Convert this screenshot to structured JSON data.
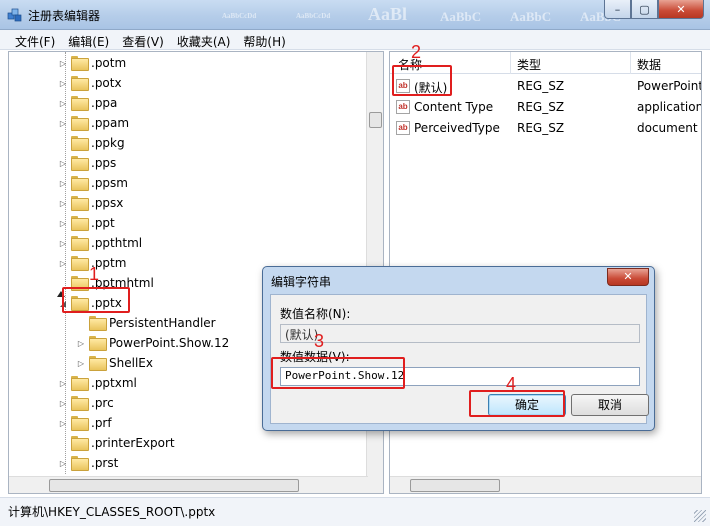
{
  "window": {
    "title": "注册表编辑器",
    "ghost_text": [
      "AaBbCcDd",
      "AaBbCcDd",
      "AaBl",
      "AaBbC",
      "AaBbC",
      "AaBbC"
    ],
    "buttons": {
      "minimize": "–",
      "maximize": "▢",
      "close": "✕"
    }
  },
  "menu": [
    "文件(F)",
    "编辑(E)",
    "查看(V)",
    "收藏夹(A)",
    "帮助(H)"
  ],
  "tree": {
    "items": [
      {
        "label": ".potm",
        "expandable": true
      },
      {
        "label": ".potx",
        "expandable": true
      },
      {
        "label": ".ppa",
        "expandable": true
      },
      {
        "label": ".ppam",
        "expandable": true
      },
      {
        "label": ".ppkg",
        "expandable": false
      },
      {
        "label": ".pps",
        "expandable": true
      },
      {
        "label": ".ppsm",
        "expandable": true
      },
      {
        "label": ".ppsx",
        "expandable": true
      },
      {
        "label": ".ppt",
        "expandable": true
      },
      {
        "label": ".ppthtml",
        "expandable": true
      },
      {
        "label": ".pptm",
        "expandable": true
      },
      {
        "label": ".pptmhtml",
        "expandable": false
      },
      {
        "label": ".pptx",
        "expanded": true
      },
      {
        "label": "PersistentHandler",
        "child": true,
        "expandable": false
      },
      {
        "label": "PowerPoint.Show.12",
        "child": true,
        "expandable": true
      },
      {
        "label": "ShellEx",
        "child": true,
        "expandable": true
      },
      {
        "label": ".pptxml",
        "expandable": true
      },
      {
        "label": ".prc",
        "expandable": true
      },
      {
        "label": ".prf",
        "expandable": true
      },
      {
        "label": ".printerExport",
        "expandable": false
      },
      {
        "label": ".prst",
        "expandable": true
      }
    ]
  },
  "list": {
    "columns": [
      "名称",
      "类型",
      "数据"
    ],
    "rows": [
      {
        "name": "(默认)",
        "type": "REG_SZ",
        "data": "PowerPoint"
      },
      {
        "name": "Content Type",
        "type": "REG_SZ",
        "data": "application"
      },
      {
        "name": "PerceivedType",
        "type": "REG_SZ",
        "data": "document"
      }
    ],
    "icon_text": "ab"
  },
  "status": {
    "path": "计算机\\HKEY_CLASSES_ROOT\\.pptx"
  },
  "dialog": {
    "title": "编辑字符串",
    "name_label": "数值名称(N):",
    "name_value": "(默认)",
    "data_label": "数值数据(V):",
    "data_value": "PowerPoint.Show.12",
    "ok_label": "确定",
    "cancel_label": "取消",
    "close_label": "✕"
  },
  "annotations": [
    "1",
    "2",
    "3",
    "4"
  ],
  "colors": {
    "annotation": "#e01e1e",
    "folder": "#e9c45d",
    "titlebar": "#b5cde9"
  }
}
